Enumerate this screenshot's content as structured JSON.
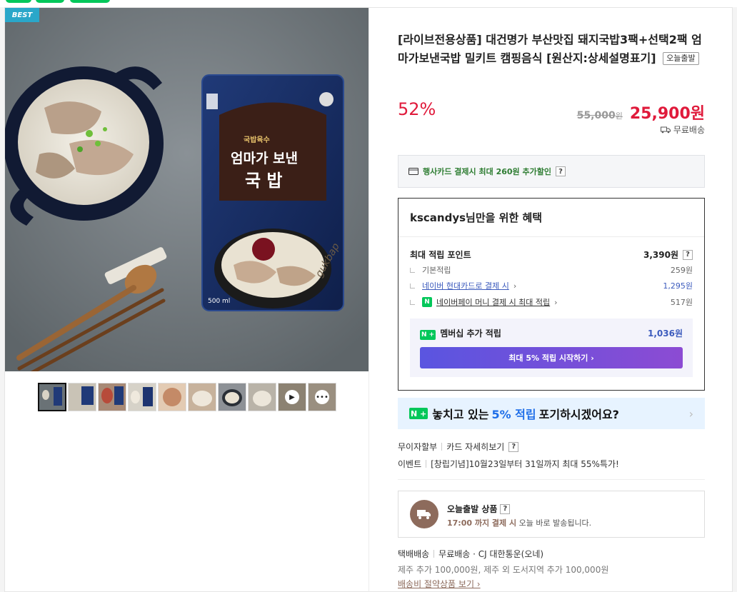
{
  "badge": "BEST",
  "product": {
    "title": "[라이브전용상품] 대건명가 부산맛집 돼지국밥3팩+선택2팩 엄마가보낸국밥 밀키트 캠핑음식 [원산지:상세설명표기]",
    "today_tag": "오늘출발",
    "discount": "52%",
    "original_price": "55,000",
    "original_unit": "원",
    "sale_price": "25,900원",
    "shipping": "무료배송",
    "package_text": {
      "small_label": "국밥육수",
      "line1": "엄마가 보낸",
      "line2": "국 밥",
      "volume": "500 ml",
      "script": "gukbap"
    }
  },
  "card_promo": {
    "text": "행사카드 결제시 최대 260원 추가할인",
    "help": "?"
  },
  "benefit": {
    "heading": "kscandys님만을 위한 혜택",
    "max_points_label": "최대 적립 포인트",
    "max_points_value": "3,390원",
    "rows": [
      {
        "label": "기본적립",
        "value": "259원"
      },
      {
        "label": "네이버 현대카드로 결제 시",
        "value": "1,295원"
      },
      {
        "label": "네이버페이 머니 결제 시 최대 적립",
        "value": "517원"
      }
    ],
    "member_label": "멤버십 추가 적립",
    "member_value": "1,036원",
    "member_button": "최대 5% 적립 시작하기 ›",
    "n_badge": "N"
  },
  "banner": {
    "pre": "놓치고 있는",
    "accent": "5% 적립",
    "post": "포기하시겠어요?",
    "arrow": "›"
  },
  "info": {
    "installment": "무이자할부",
    "card_detail": "카드 자세히보기",
    "event_label": "이벤트",
    "event_text": "[창립기념]10월23일부터 31일까지 최대 55%특가!"
  },
  "today_ship": {
    "title": "오늘출발 상품",
    "deadline": "17:00 까지 결제 시",
    "rest": "오늘 바로 발송됩니다."
  },
  "delivery": {
    "type": "택배배송",
    "detail": "무료배송 · CJ 대한통운(오네)",
    "extra": "제주 추가 100,000원, 제주 외 도서지역 추가 100,000원",
    "saving_link": "배송비 절약상품 보기 ›"
  },
  "colors": {
    "sale_red": "#e01a3b",
    "naver_green": "#03c75a",
    "accent_blue": "#1e6ee8",
    "brown": "#8d6b5c"
  },
  "thumbnails": [
    "thumb-1",
    "thumb-2",
    "thumb-3",
    "thumb-4",
    "thumb-5",
    "thumb-6",
    "thumb-7",
    "thumb-8",
    "video-play-icon",
    "more-icon"
  ]
}
